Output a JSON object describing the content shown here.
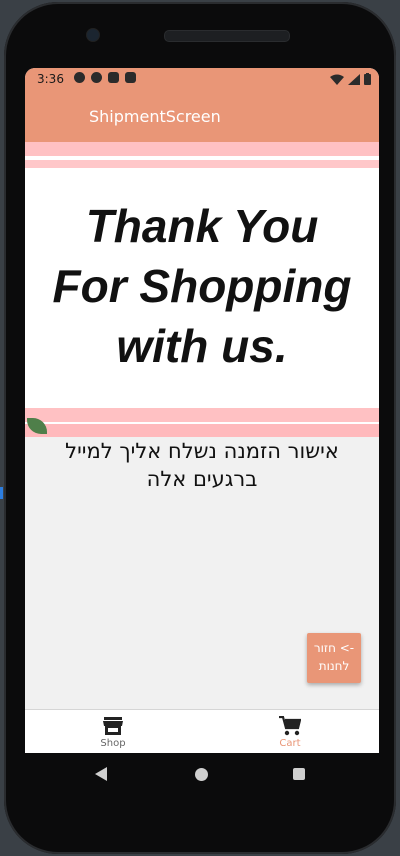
{
  "status_bar": {
    "time": "3:36",
    "icons": [
      "gear-icon",
      "app-a-icon",
      "play-protect-icon",
      "sd-card-icon"
    ],
    "right_icons": [
      "wifi-icon",
      "signal-icon",
      "battery-icon"
    ]
  },
  "app_bar": {
    "title": "ShipmentScreen"
  },
  "hero": {
    "lines": [
      "Thank You",
      "For Shopping",
      "with us."
    ]
  },
  "message": "אישור הזמנה נשלח אליך למייל ברגעים אלה",
  "back_button": {
    "label": "-> חזור לחנות"
  },
  "bottom_nav": {
    "items": [
      {
        "label": "Shop",
        "icon": "store-icon",
        "active": false
      },
      {
        "label": "Cart",
        "icon": "cart-icon",
        "active": true
      }
    ]
  },
  "colors": {
    "accent": "#e99677",
    "stripe_pink": "#ffc1c3"
  }
}
